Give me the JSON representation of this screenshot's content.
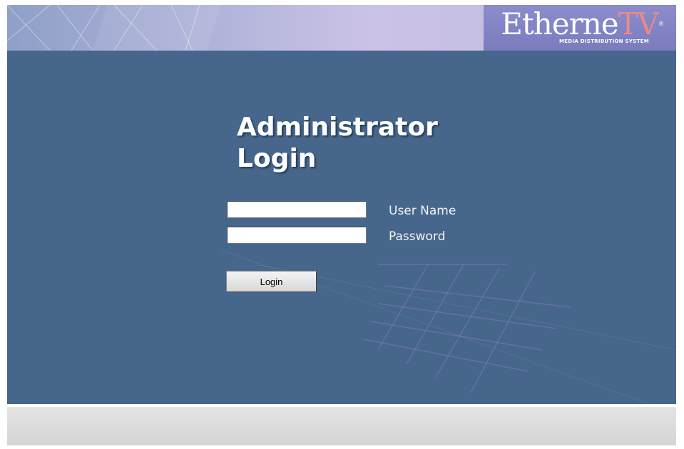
{
  "header": {
    "logo": {
      "brand_main": "Etherne",
      "brand_accent": "TV",
      "registered_mark": "®",
      "tagline": "MEDIA DISTRIBUTION SYSTEM"
    }
  },
  "login": {
    "title_line1": "Administrator",
    "title_line2": "Login",
    "username_label": "User Name",
    "username_value": "",
    "password_label": "Password",
    "password_value": "",
    "login_button": "Login"
  },
  "colors": {
    "main_background": "#46668b",
    "header_gradient_mid": "#cbc3e6",
    "logo_background": "#7a7cbd",
    "logo_accent": "#e88a8a",
    "footer": "#d9d9d9"
  }
}
